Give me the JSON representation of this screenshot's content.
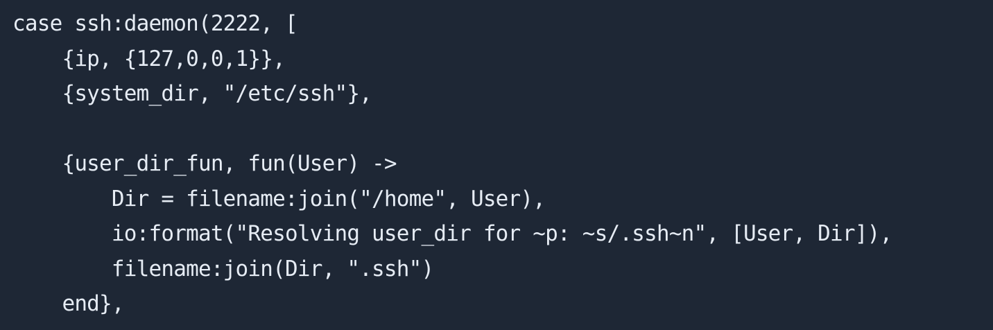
{
  "editor": {
    "background": "#1e2735",
    "text_color": "#e6ecf4",
    "lines": [
      "case ssh:daemon(2222, [",
      "    {ip, {127,0,0,1}},",
      "    {system_dir, \"/etc/ssh\"},",
      "",
      "    {user_dir_fun, fun(User) ->",
      "        Dir = filename:join(\"/home\", User),",
      "        io:format(\"Resolving user_dir for ~p: ~s/.ssh~n\", [User, Dir]),",
      "        filename:join(Dir, \".ssh\")",
      "    end},"
    ]
  }
}
